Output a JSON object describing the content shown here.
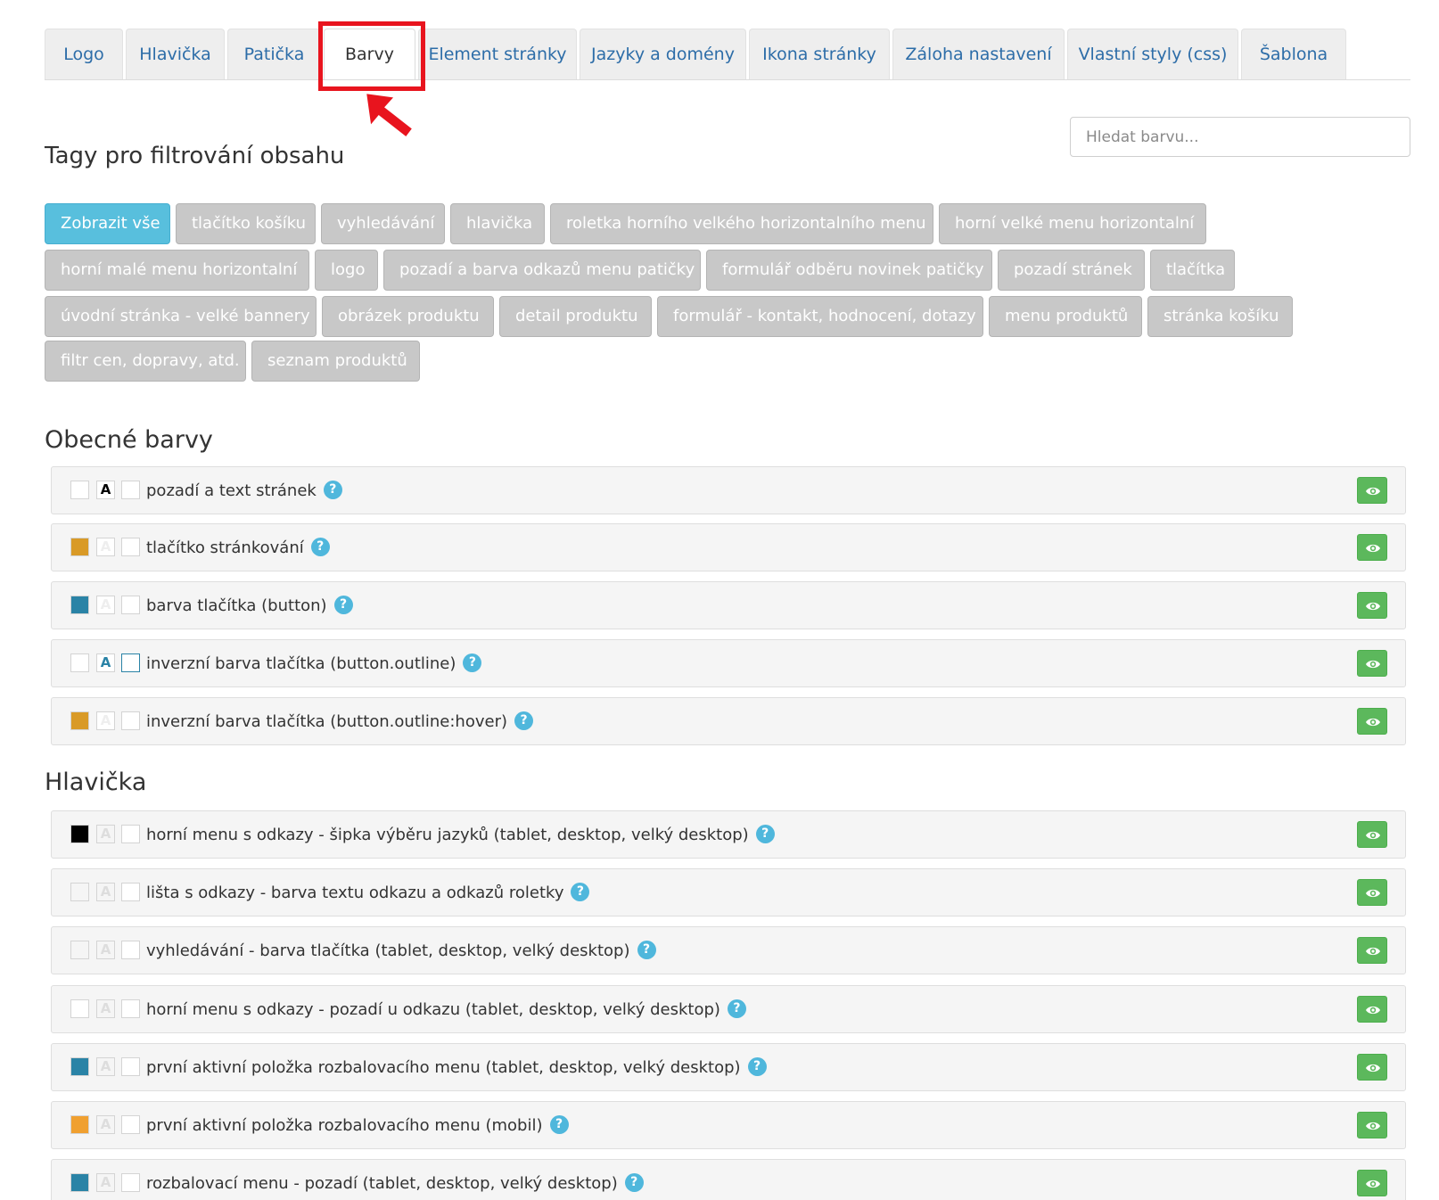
{
  "tabs": [
    {
      "label": "Logo"
    },
    {
      "label": "Hlavička"
    },
    {
      "label": "Patička"
    },
    {
      "label": "Barvy"
    },
    {
      "label": "Element stránky"
    },
    {
      "label": "Jazyky a domény"
    },
    {
      "label": "Ikona stránky"
    },
    {
      "label": "Záloha nastavení"
    },
    {
      "label": "Vlastní styly (css)"
    },
    {
      "label": "Šablona"
    }
  ],
  "active_tab": "Barvy",
  "search": {
    "placeholder": "Hledat barvu..."
  },
  "tags_heading": "Tagy pro filtrování obsahu",
  "tags": [
    {
      "label": "Zobrazit vše",
      "active": true
    },
    {
      "label": "tlačítko košíku"
    },
    {
      "label": "vyhledávání"
    },
    {
      "label": "hlavička"
    },
    {
      "label": "roletka horního velkého horizontalního menu"
    },
    {
      "label": "horní velké menu horizontalní"
    },
    {
      "label": "horní malé menu horizontalní"
    },
    {
      "label": "logo"
    },
    {
      "label": "pozadí a barva odkazů menu patičky"
    },
    {
      "label": "formulář odběru novinek patičky"
    },
    {
      "label": "pozadí stránek"
    },
    {
      "label": "tlačítka"
    },
    {
      "label": "úvodní stránka - velké bannery"
    },
    {
      "label": "obrázek produktu"
    },
    {
      "label": "detail produktu"
    },
    {
      "label": "formulář - kontakt, hodnocení, dotazy"
    },
    {
      "label": "menu produktů"
    },
    {
      "label": "stránka košíku"
    },
    {
      "label": "filtr cen, dopravy, atd."
    },
    {
      "label": "seznam produktů"
    }
  ],
  "sections": [
    {
      "title": "Obecné barvy",
      "rows": [
        {
          "label": "pozadí a text stránek",
          "help": "?",
          "bg": "#ffffff",
          "letter": "A",
          "letter_color": "#000000",
          "letter_bg": "#ffffff",
          "border": "#d4d4d4"
        },
        {
          "label": "tlačítko stránkování",
          "help": "?",
          "bg": "#d99a27",
          "letter": "A",
          "letter_color": "#eeeeee",
          "letter_bg": "#ffffff",
          "border": "#d4d4d4"
        },
        {
          "label": "barva tlačítka (button)",
          "help": "?",
          "bg": "#2a83a6",
          "letter": "A",
          "letter_color": "#eeeeee",
          "letter_bg": "#ffffff",
          "border": "#d4d4d4"
        },
        {
          "label": "inverzní barva tlačítka (button.outline)",
          "help": "?",
          "bg": "#ffffff",
          "letter": "A",
          "letter_color": "#2a83a6",
          "letter_bg": "#ffffff",
          "border": "#2a83a6"
        },
        {
          "label": "inverzní barva tlačítka (button.outline:hover)",
          "help": "?",
          "bg": "#d99a27",
          "letter": "A",
          "letter_color": "#eeeeee",
          "letter_bg": "#ffffff",
          "border": "#d4d4d4"
        }
      ]
    },
    {
      "title": "Hlavička",
      "rows": [
        {
          "label": "horní menu s odkazy - šipka výběru jazyků (tablet, desktop, velký desktop)",
          "help": "?",
          "bg": "#000000",
          "letter": "A",
          "letter_color": "#dddddd",
          "letter_bg": "#f5f5f5",
          "border": "#d4d4d4"
        },
        {
          "label": "lišta s odkazy - barva textu odkazu a odkazů roletky",
          "help": "?",
          "bg": "#f5f5f5",
          "letter": "A",
          "letter_color": "#dddddd",
          "letter_bg": "#f5f5f5",
          "border": "#d4d4d4"
        },
        {
          "label": "vyhledávání - barva tlačítka (tablet, desktop, velký desktop)",
          "help": "?",
          "bg": "#f5f5f5",
          "letter": "A",
          "letter_color": "#dddddd",
          "letter_bg": "#f5f5f5",
          "border": "#d4d4d4"
        },
        {
          "label": "horní menu s odkazy - pozadí u odkazu (tablet, desktop, velký desktop)",
          "help": "?",
          "bg": "#ffffff",
          "letter": "A",
          "letter_color": "#dddddd",
          "letter_bg": "#f5f5f5",
          "border": "#d4d4d4"
        },
        {
          "label": "první aktivní položka rozbalovacího menu (tablet, desktop, velký desktop)",
          "help": "?",
          "bg": "#2a83a6",
          "letter": "A",
          "letter_color": "#dddddd",
          "letter_bg": "#f5f5f5",
          "border": "#d4d4d4"
        },
        {
          "label": "první aktivní položka rozbalovacího menu (mobil)",
          "help": "?",
          "bg": "#f0a030",
          "letter": "A",
          "letter_color": "#dddddd",
          "letter_bg": "#f5f5f5",
          "border": "#d4d4d4"
        },
        {
          "label": "rozbalovací menu - pozadí (tablet, desktop, velký desktop)",
          "help": "?",
          "bg": "#2a83a6",
          "letter": "A",
          "letter_color": "#dddddd",
          "letter_bg": "#f5f5f5",
          "border": "#d4d4d4"
        }
      ]
    }
  ],
  "icons": {
    "eye": "eye-icon",
    "help": "question-icon",
    "pointer": "red-arrow-annotation"
  },
  "colors": {
    "tab_link": "#2d6da8",
    "tag_active": "#58bfdd",
    "tag": "#c8c8c8",
    "eye_button": "#5cb85c",
    "highlight": "#e8141e"
  }
}
